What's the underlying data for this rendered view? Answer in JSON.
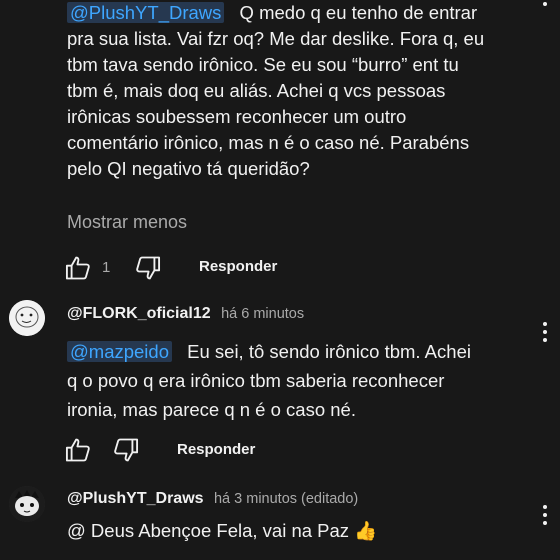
{
  "comment1": {
    "mention": "@PlushYT_Draws",
    "line1": "Q medo q eu tenho de entrar",
    "lines": [
      "pra sua lista. Vai fzr oq? Me dar deslike. Fora q, eu",
      "tbm tava sendo irônico. Se eu sou “burro” ent tu",
      "tbm é, mais doq eu aliás. Achei q vcs pessoas",
      "irônicas soubessem reconhecer um outro",
      "comentário irônico, mas n é o caso né. Parabéns",
      "pelo QI negativo tá queridão?"
    ],
    "show_less": "Mostrar menos",
    "like_count": "1",
    "reply_label": "Responder"
  },
  "comment2": {
    "author": "@FLORK_oficial12",
    "time": "há 6 minutos",
    "mention": "@mazpeido",
    "line1": "Eu sei, tô sendo irônico tbm. Achei",
    "lines": [
      "q o povo q era irônico tbm saberia reconhecer",
      "ironia, mas parece q n é o caso né."
    ],
    "reply_label": "Responder"
  },
  "comment3": {
    "author": "@PlushYT_Draws",
    "time": "há 3 minutos (editado)",
    "text": "@ Deus Abençoe Fela, vai na Paz",
    "emoji": "👍"
  },
  "colors": {
    "background": "#181818",
    "text": "#f1f1f1",
    "secondary": "#aaaaaa",
    "link": "#3ea6ff",
    "mention_bg": "#263850"
  },
  "icons": [
    "like-icon",
    "dislike-icon",
    "more-vert-icon",
    "avatar"
  ]
}
